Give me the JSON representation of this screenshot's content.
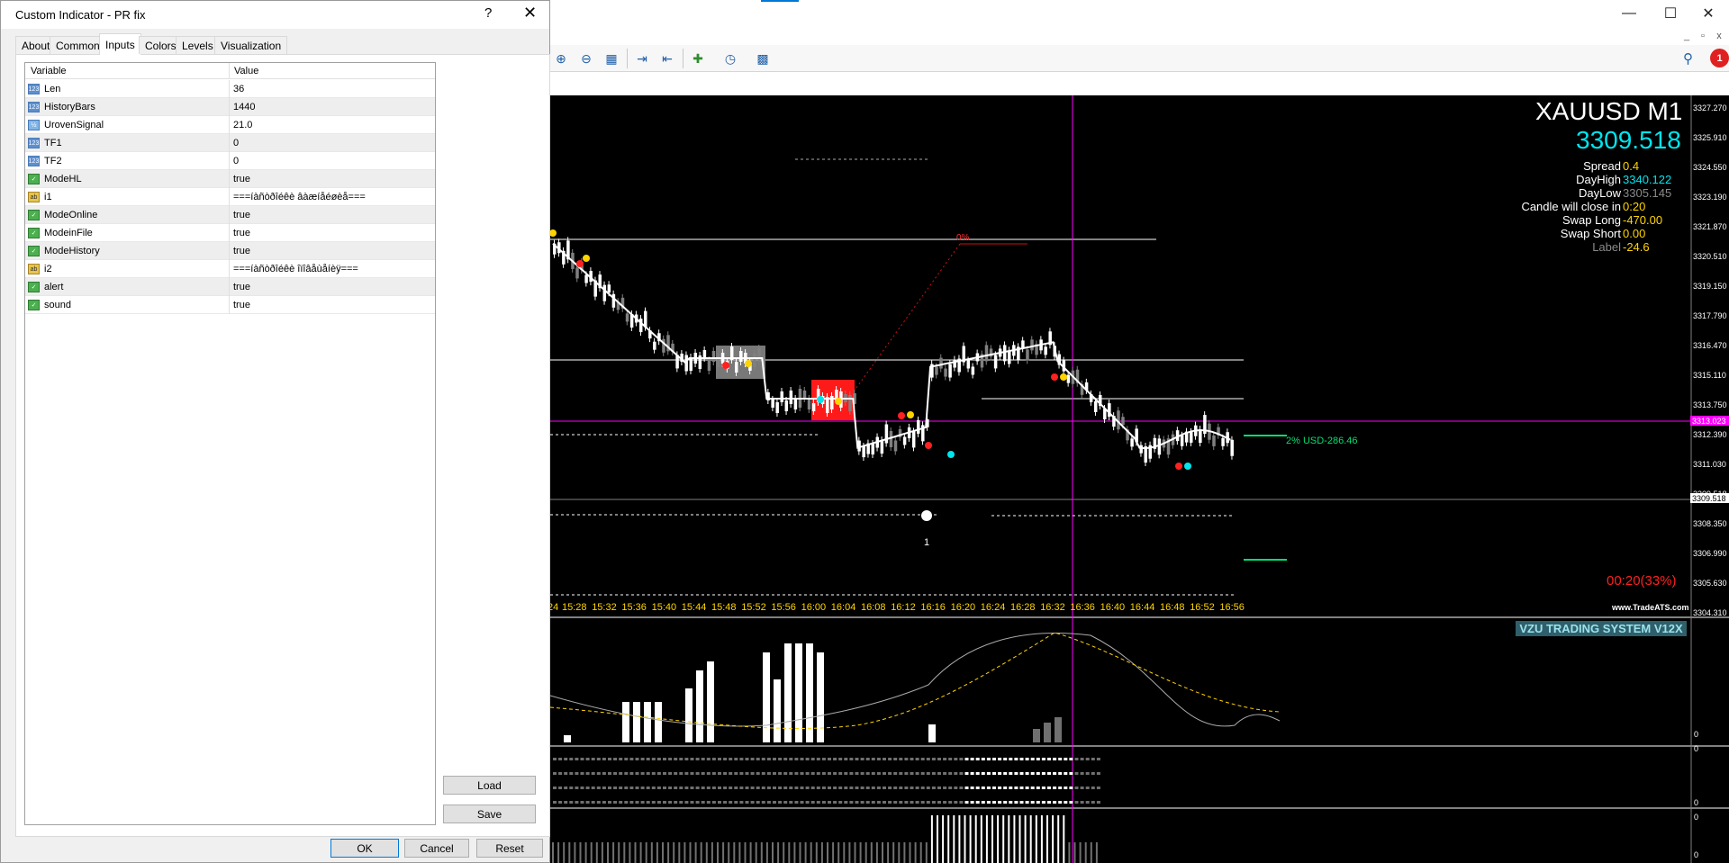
{
  "dialog": {
    "title": "Custom Indicator - PR fix",
    "help_glyph": "?",
    "close_glyph": "✕",
    "tabs": [
      {
        "label": "About"
      },
      {
        "label": "Common"
      },
      {
        "label": "Inputs",
        "active": true
      },
      {
        "label": "Colors"
      },
      {
        "label": "Levels"
      },
      {
        "label": "Visualization"
      }
    ],
    "grid_header": {
      "variable": "Variable",
      "value": "Value"
    },
    "inputs": [
      {
        "icon": "int-icon",
        "badge": "123",
        "variable": "Len",
        "value": "36"
      },
      {
        "icon": "int-icon",
        "badge": "123",
        "variable": "HistoryBars",
        "value": "1440"
      },
      {
        "icon": "double-icon",
        "badge": "½",
        "variable": "UrovenSignal",
        "value": "21.0"
      },
      {
        "icon": "int-icon",
        "badge": "123",
        "variable": "TF1",
        "value": "0"
      },
      {
        "icon": "int-icon",
        "badge": "123",
        "variable": "TF2",
        "value": "0"
      },
      {
        "icon": "bool-icon",
        "badge": "✓",
        "variable": "ModeHL",
        "value": "true"
      },
      {
        "icon": "string-icon",
        "badge": "ab",
        "variable": "i1",
        "value": "===íàñòðîéêè âàæíåéøèå==="
      },
      {
        "icon": "bool-icon",
        "badge": "✓",
        "variable": "ModeOnline",
        "value": "true"
      },
      {
        "icon": "bool-icon",
        "badge": "✓",
        "variable": "ModeinFile",
        "value": "true"
      },
      {
        "icon": "bool-icon",
        "badge": "✓",
        "variable": "ModeHistory",
        "value": "true"
      },
      {
        "icon": "string-icon",
        "badge": "ab",
        "variable": "i2",
        "value": "===íàñòðîéêè îïîâåùåíèÿ==="
      },
      {
        "icon": "bool-icon",
        "badge": "✓",
        "variable": "alert",
        "value": "true"
      },
      {
        "icon": "bool-icon",
        "badge": "✓",
        "variable": "sound",
        "value": "true"
      }
    ],
    "buttons": {
      "load": "Load",
      "save": "Save",
      "ok": "OK",
      "cancel": "Cancel",
      "reset": "Reset"
    }
  },
  "window": {
    "minimize": "—",
    "maximize": "☐",
    "close": "✕",
    "mdi": [
      "_",
      "▫",
      "x"
    ]
  },
  "toolbar": {
    "icons": [
      "zoom-in-icon",
      "zoom-out-icon",
      "tile-icon",
      "autoscroll-icon",
      "chart-shift-icon",
      "indicators-icon",
      "periods-icon",
      "templates-icon"
    ],
    "glyphs": [
      "⊕",
      "⊖",
      "▦",
      "⇥",
      "⇤",
      "✚",
      "◷",
      "▩"
    ],
    "search_glyph": "⚲",
    "notifications": "1"
  },
  "chart": {
    "symbol": "XAUUSD M1",
    "price": "3309.518",
    "info": [
      {
        "label": "Spread",
        "value": "0.4",
        "color": "#ffd400"
      },
      {
        "label": "DayHigh",
        "value": "3340.122",
        "color": "#00e5ee"
      },
      {
        "label": "DayLow",
        "value": "3305.145",
        "color": "#8a8a8a"
      },
      {
        "label": "Candle will close in",
        "value": "0:20",
        "color": "#ffd400"
      },
      {
        "label": "Swap Long",
        "value": "-470.00",
        "color": "#ffd400"
      },
      {
        "label": "Swap Short",
        "value": "0.00",
        "color": "#ffd400"
      },
      {
        "label": "Label",
        "value": "-24.6",
        "color": "#ffd400"
      }
    ],
    "candle_timer": "00:20(33%)",
    "watermark": "www.TradeATS.com",
    "risk_label": "2% USD-286.46",
    "line_label": "0%",
    "mark_label": "1",
    "price_axis": [
      "3327.270",
      "3325.910",
      "3324.550",
      "3323.190",
      "3321.870",
      "3320.510",
      "3319.150",
      "3317.790",
      "3316.470",
      "3315.110",
      "3313.750",
      "3312.390",
      "3311.030",
      "3309.518",
      "3308.350",
      "3306.990",
      "3305.630",
      "3304.310"
    ],
    "tag_magenta": "3313.023",
    "tag_current": "3309.518",
    "time_axis": [
      "24",
      "15:28",
      "15:32",
      "15:36",
      "15:40",
      "15:44",
      "15:48",
      "15:52",
      "15:56",
      "16:00",
      "16:04",
      "16:08",
      "16:12",
      "16:16",
      "16:20",
      "16:24",
      "16:28",
      "16:32",
      "16:36",
      "16:40",
      "16:44",
      "16:48",
      "16:52",
      "16:56"
    ],
    "subwindow_title": "VZU TRADING SYSTEM V12X",
    "sub_ticks": [
      "0",
      "0",
      "0",
      "0",
      "0"
    ],
    "colors": {
      "background": "#000000",
      "bull": "#ffffff",
      "bear": "#808080",
      "signal": "#ff00ff",
      "yellow": "#ffd400",
      "cyan": "#00e5ee"
    }
  }
}
